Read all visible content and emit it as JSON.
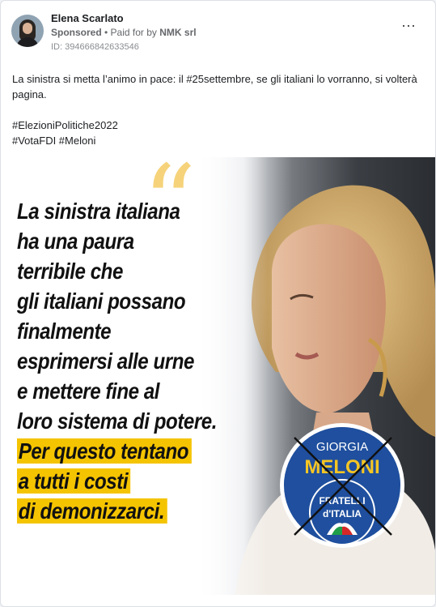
{
  "post": {
    "author_name": "Elena Scarlato",
    "sponsored_label": "Sponsored",
    "separator": " • ",
    "paid_for_label": "Paid for by ",
    "payer": "NMK srl",
    "ad_id": "ID: 394666842633546",
    "more_icon": "⋯",
    "text_line1": "La sinistra si metta l’animo in pace: il #25settembre, se gli italiani lo vorranno, si volterà pagina.",
    "text_line2": "#ElezioniPolitiche2022",
    "text_line3": "#VotaFDI #Meloni"
  },
  "creative": {
    "quote_marks": "“",
    "headline_lines": [
      "La sinistra italiana",
      "ha una paura",
      "terribile che",
      "gli italiani possano",
      "finalmente",
      "esprimersi alle urne",
      "e mettere fine al",
      "loro sistema di potere."
    ],
    "highlight_lines": [
      "Per questo tentano",
      "a tutti i costi",
      "di demonizzarci."
    ],
    "logo_top": "GIORGIA",
    "logo_name": "MELONI",
    "logo_party_1": "FRATELLI",
    "logo_party_2": "d'ITALIA"
  },
  "colors": {
    "highlight": "#f5c400",
    "logo_blue": "#1f4f9e",
    "logo_gold": "#f6c623"
  }
}
